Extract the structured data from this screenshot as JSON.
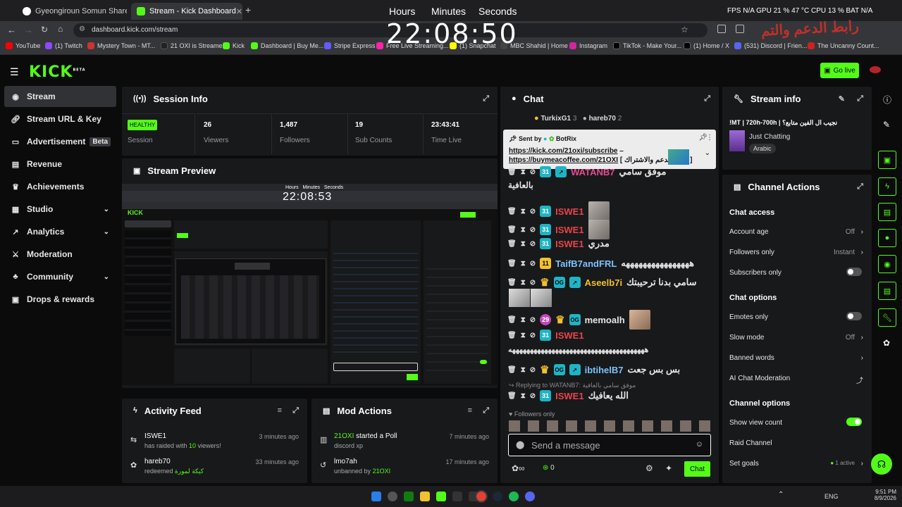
{
  "browser": {
    "tabs": [
      {
        "label": "Gyeongiroun Somun Shared by"
      },
      {
        "label": "Stream - Kick Dashboard"
      }
    ],
    "new_tab": "+",
    "url": "dashboard.kick.com/stream",
    "bookmarks": [
      "YouTube",
      "(1) Twitch",
      "Mystery Town - MT...",
      "21 OXI is Streamer",
      "Kick",
      "Dashboard | Buy Me...",
      "Stripe Express",
      "Free Live Streaming...",
      "(1) Snapchat",
      "MBC Shahid | Home",
      "Instagram",
      "TikTok - Make Your...",
      "(1) Home / X",
      "(531) Discord | Frien...",
      "The Uncanny Count..."
    ]
  },
  "overlay": {
    "clock_labels": {
      "hours": "Hours",
      "minutes": "Minutes",
      "seconds": "Seconds"
    },
    "clock": "22:08:50",
    "stats": "FPS N/A   GPU 21 % 47 °C   CPU 13 %   BAT N/A",
    "corner_text": "رابط الدعم والتم"
  },
  "header": {
    "logo": "KICK",
    "logo_sup": "BETA",
    "go_live": "Go live"
  },
  "sidebar": {
    "items": [
      {
        "label": "Stream",
        "icon": "broadcast-icon"
      },
      {
        "label": "Stream URL & Key",
        "icon": "link-icon"
      },
      {
        "label": "Advertisement",
        "icon": "ad-icon",
        "badge": "Beta"
      },
      {
        "label": "Revenue",
        "icon": "chart-icon"
      },
      {
        "label": "Achievements",
        "icon": "trophy-icon"
      },
      {
        "label": "Studio",
        "icon": "studio-icon"
      },
      {
        "label": "Analytics",
        "icon": "analytics-icon"
      },
      {
        "label": "Moderation",
        "icon": "shield-icon"
      },
      {
        "label": "Community",
        "icon": "community-icon"
      },
      {
        "label": "Drops & rewards",
        "icon": "gift-icon"
      }
    ]
  },
  "session": {
    "title": "Session Info",
    "health": "HEALTHY",
    "health_label": "Session",
    "stats": [
      {
        "value": "26",
        "label": "Viewers"
      },
      {
        "value": "1,487",
        "label": "Followers"
      },
      {
        "value": "19",
        "label": "Sub Counts"
      },
      {
        "value": "23:43:41",
        "label": "Time Live"
      }
    ]
  },
  "preview": {
    "title": "Stream Preview",
    "mini_clock": "22:08:53",
    "mini_clock_labels": {
      "hours": "Hours",
      "minutes": "Minutes",
      "seconds": "Seconds"
    }
  },
  "activity": {
    "title": "Activity Feed",
    "items": [
      {
        "name": "ISWE1",
        "text_pre": "has raided with ",
        "highlight": "10",
        "text_post": " viewers!",
        "time": "3 minutes ago"
      },
      {
        "name": "hareb70",
        "text_pre": "redeemed ",
        "highlight": "كيكة لمورة",
        "text_post": "",
        "time": "33 minutes ago"
      }
    ]
  },
  "mod_actions": {
    "title": "Mod Actions",
    "items": [
      {
        "name": "21OXI",
        "text": " started a Poll",
        "sub": "discord xp",
        "sub_highlight": "",
        "time": "7 minutes ago"
      },
      {
        "name": "lmo7ah",
        "text": "",
        "sub": "unbanned by ",
        "sub_highlight": "21OXI",
        "time": "17 minutes ago"
      }
    ]
  },
  "chat": {
    "title": "Chat",
    "top_users": [
      {
        "name": "TurkixG1",
        "count": "3"
      },
      {
        "name": "hareb70",
        "count": "2"
      }
    ],
    "pinned": {
      "sent_by": "Sent by",
      "bot": "BotRix",
      "line1": "https://kick.com/21oxi/subscribe",
      "line1_suffix": " –",
      "line2": "https://buymeacoffee.com/21OXI",
      "line2_suffix": " [ رابط الدعم والاشتراك ]"
    },
    "messages": [
      {
        "user": "WATANB7",
        "text": "موفق سامي",
        "cont": "بالعافية"
      },
      {
        "user": "ISWE1",
        "text": ""
      },
      {
        "user": "ISWE1",
        "text": ""
      },
      {
        "user": "ISWE1",
        "text": "مدري"
      },
      {
        "user": "TaifB7andFRL",
        "text": "ههههههههههههههههه",
        "badge": "11"
      },
      {
        "user": "Aseelb7i",
        "text": "سامي بدنا ترحيبتك"
      },
      {
        "user": "memoalh",
        "text": "",
        "badge": "29"
      },
      {
        "user": "ISWE1",
        "text": "",
        "cont": "ههههههههههههههههههههههههههههههههههههههه"
      },
      {
        "user": "ibtihelB7",
        "text": "بس بس جعت"
      },
      {
        "user": "ISWE1",
        "text": "الله يعافيك"
      }
    ],
    "reply_to": "Replying to WATANB7:",
    "reply_quote": "موفق سامي بالعافية",
    "followers_only": "Followers only",
    "input_placeholder": "Send a message",
    "points": "0",
    "send": "Chat"
  },
  "stream_info": {
    "title": "Stream info",
    "stream_title": "!MT | 720h-700h | نجيب ال الفين متابع؟",
    "category": "Just Chatting",
    "tag": "Arabic"
  },
  "channel_actions": {
    "title": "Channel Actions",
    "sections": [
      {
        "heading": "Chat access",
        "rows": [
          {
            "label": "Account age",
            "value": "Off",
            "kind": "arrow"
          },
          {
            "label": "Followers only",
            "value": "Instant",
            "kind": "arrow-green"
          },
          {
            "label": "Subscribers only",
            "value": "",
            "kind": "toggle-off"
          }
        ]
      },
      {
        "heading": "Chat options",
        "rows": [
          {
            "label": "Emotes only",
            "value": "",
            "kind": "toggle-off"
          },
          {
            "label": "Slow mode",
            "value": "Off",
            "kind": "arrow"
          },
          {
            "label": "Banned words",
            "value": "",
            "kind": "arrow"
          },
          {
            "label": "AI Chat Moderation",
            "value": "",
            "kind": "external"
          }
        ]
      },
      {
        "heading": "Channel options",
        "rows": [
          {
            "label": "Show view count",
            "value": "",
            "kind": "toggle-on"
          },
          {
            "label": "Raid Channel",
            "value": "",
            "kind": "none"
          },
          {
            "label": "Set goals",
            "value": "1 active",
            "kind": "arrow"
          }
        ]
      }
    ]
  },
  "taskbar": {
    "lang": "ENG",
    "time": "9:51 PM",
    "date": "8/9/2026"
  },
  "colors": {
    "accent": "#53fc18",
    "bg": "#0b0b0c",
    "panel": "#18191b",
    "sub_badge": "#1fb4c4",
    "crown": "#f2c12e"
  }
}
